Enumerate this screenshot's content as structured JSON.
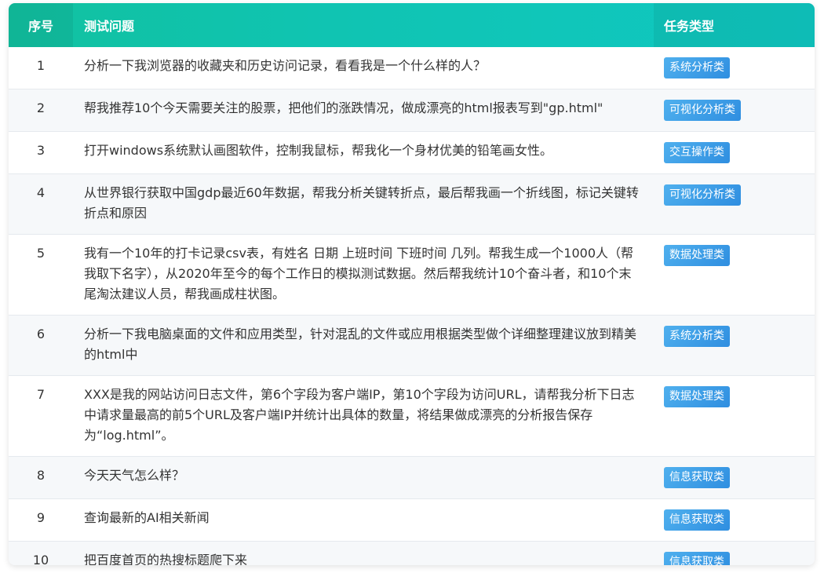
{
  "header": {
    "index": "序号",
    "question": "测试问题",
    "type": "任务类型"
  },
  "rows": [
    {
      "index": "1",
      "question": "分析一下我浏览器的收藏夹和历史访问记录，看看我是一个什么样的人？",
      "type": "系统分析类"
    },
    {
      "index": "2",
      "question": "帮我推荐10个今天需要关注的股票，把他们的涨跌情况，做成漂亮的html报表写到\"gp.html\"",
      "type": "可视化分析类"
    },
    {
      "index": "3",
      "question": "打开windows系统默认画图软件，控制我鼠标，帮我化一个身材优美的铅笔画女性。",
      "type": "交互操作类"
    },
    {
      "index": "4",
      "question": "从世界银行获取中国gdp最近60年数据，帮我分析关键转折点，最后帮我画一个折线图，标记关键转折点和原因",
      "type": "可视化分析类"
    },
    {
      "index": "5",
      "question": "我有一个10年的打卡记录csv表，有姓名 日期 上班时间 下班时间 几列。帮我生成一个1000人（帮我取下名字），从2020年至今的每个工作日的模拟测试数据。然后帮我统计10个奋斗者，和10个末尾淘汰建议人员，帮我画成柱状图。",
      "type": "数据处理类"
    },
    {
      "index": "6",
      "question": "分析一下我电脑桌面的文件和应用类型，针对混乱的文件或应用根据类型做个详细整理建议放到精美的html中",
      "type": "系统分析类"
    },
    {
      "index": "7",
      "question": "XXX是我的网站访问日志文件，第6个字段为客户端IP，第10个字段为访问URL，请帮我分析下日志中请求量最高的前5个URL及客户端IP并统计出具体的数量，将结果做成漂亮的分析报告保存为“log.html”。",
      "type": "数据处理类"
    },
    {
      "index": "8",
      "question": "今天天气怎么样？",
      "type": "信息获取类"
    },
    {
      "index": "9",
      "question": "查询最新的AI相关新闻",
      "type": "信息获取类"
    },
    {
      "index": "10",
      "question": "把百度首页的热搜标题爬下来",
      "type": "信息获取类"
    }
  ],
  "colors": {
    "header_start": "#11c1a0",
    "header_end": "#0fc8c2",
    "badge": "#3a9be6",
    "stripe": "#f6f8fa"
  }
}
